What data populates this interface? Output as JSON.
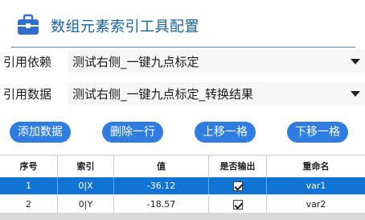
{
  "header": {
    "title": "数组元素索引工具配置",
    "icon": "briefcase-icon",
    "accent": "#1565a6"
  },
  "form": {
    "reference_dependency": {
      "label": "引用依赖",
      "value": "测试右侧_一键九点标定"
    },
    "reference_data": {
      "label": "引用数据",
      "value": "测试右侧_一键九点标定_转换结果"
    }
  },
  "buttons": {
    "add_data": "添加数据",
    "delete_row": "删除一行",
    "move_up": "上移一格",
    "move_down": "下移一格",
    "color": "#2f7de1"
  },
  "table": {
    "columns": [
      "序号",
      "索引",
      "值",
      "是否输出",
      "重命名"
    ],
    "rows": [
      {
        "index": "1",
        "key": "0|X",
        "value": "-36.12",
        "output": true,
        "rename": "var1",
        "selected": true
      },
      {
        "index": "2",
        "key": "0|Y",
        "value": "-18.57",
        "output": true,
        "rename": "var2",
        "selected": false
      }
    ]
  }
}
